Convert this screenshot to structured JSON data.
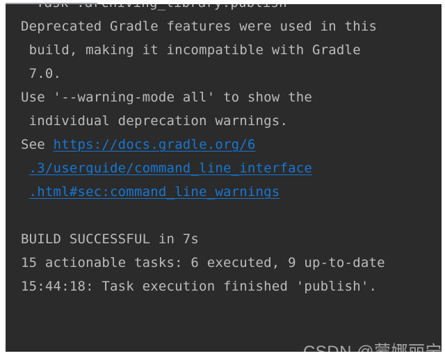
{
  "window": {
    "kind": "ide-build-console",
    "background_color": "#2b2b2b",
    "text_color": "#bcbcbc",
    "link_color": "#1877d2",
    "frame_color": "#ffffff"
  },
  "console": {
    "clipped_top_line": "Task :archiving_library:publish",
    "lines": [
      {
        "id": "l1",
        "text": "Deprecated Gradle features were used in this",
        "type": "text"
      },
      {
        "id": "l2",
        "text": " build, making it incompatible with Gradle",
        "type": "text"
      },
      {
        "id": "l3",
        "text": " 7.0.",
        "type": "text"
      },
      {
        "id": "l4",
        "text": "Use '--warning-mode all' to show the",
        "type": "text"
      },
      {
        "id": "l5",
        "text": " individual deprecation warnings.",
        "type": "text"
      },
      {
        "id": "l6",
        "prefix": "See ",
        "link": "https://docs.gradle.org/6",
        "type": "link"
      },
      {
        "id": "l7",
        "prefix": " ",
        "link": ".3/userguide/command_line_interface",
        "type": "link"
      },
      {
        "id": "l8",
        "prefix": " ",
        "link": ".html#sec:command_line_warnings",
        "type": "link"
      },
      {
        "id": "l9",
        "text": "",
        "type": "blank"
      },
      {
        "id": "l10",
        "text": "BUILD SUCCESSFUL in 7s",
        "type": "text"
      },
      {
        "id": "l11",
        "text": "15 actionable tasks: 6 executed, 9 up-to-date",
        "type": "text"
      },
      {
        "id": "l12",
        "text": "15:44:18: Task execution finished 'publish'.",
        "type": "text"
      }
    ]
  },
  "watermark": {
    "text": "CSDN @蒙娜丽宁"
  }
}
